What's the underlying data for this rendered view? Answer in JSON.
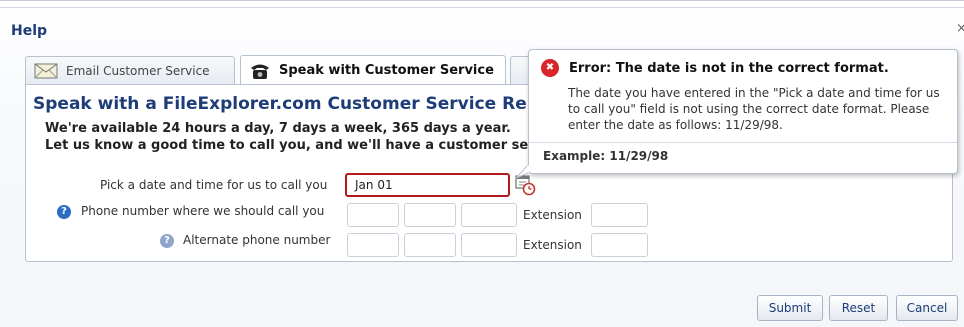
{
  "dialog": {
    "title": "Help"
  },
  "tabs": [
    {
      "label": "Email Customer Service",
      "icon": "envelope-icon",
      "active": false
    },
    {
      "label": "Speak with Customer Service",
      "icon": "telephone-icon",
      "active": true
    }
  ],
  "panel": {
    "heading": "Speak with a FileExplorer.com Customer Service Representative",
    "line1": "We're available 24 hours a day, 7 days a week, 365 days a year.",
    "line2": "Let us know a good time to call you, and we'll have a customer service representative call you."
  },
  "form": {
    "date_label": "Pick a date and time for us to call you",
    "date_value": "Jan 01",
    "phone_label": "Phone number where we should call you",
    "alt_phone_label": "Alternate phone number",
    "extension_label": "Extension",
    "help_glyph": "?"
  },
  "error_tip": {
    "title": "Error: The date is not in the correct format.",
    "message": "The date you have entered in the \"Pick a date and time for us to call you\" field is not using the correct date format. Please enter the date as follows: 11/29/98.",
    "example": "Example: 11/29/98",
    "icon_glyph": "✖"
  },
  "buttons": {
    "submit": "Submit",
    "reset": "Reset",
    "cancel": "Cancel"
  },
  "colors": {
    "title_blue": "#1d3c78",
    "error_red": "#d8262b",
    "help_blue": "#2b6cc4"
  }
}
